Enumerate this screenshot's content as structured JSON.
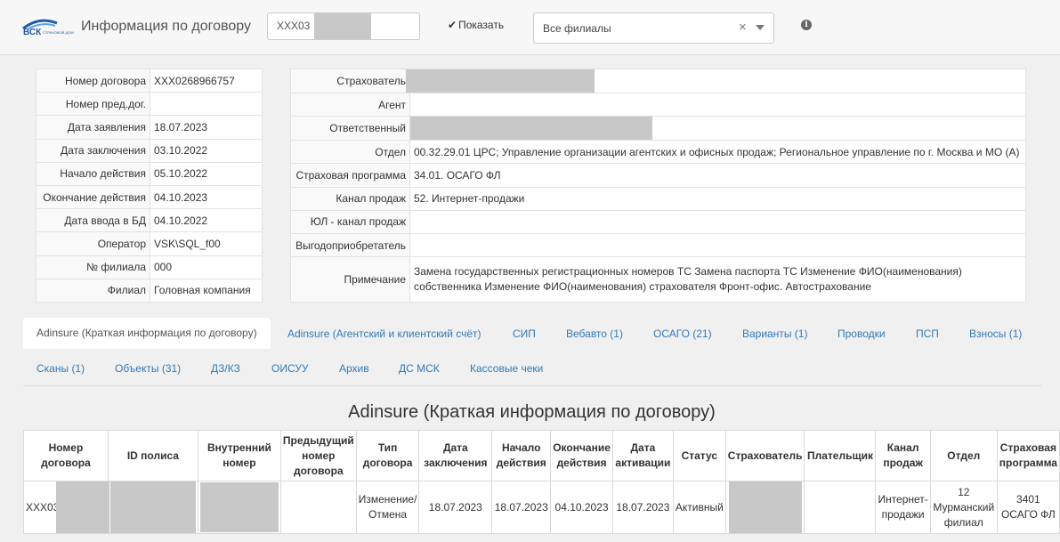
{
  "header": {
    "logo_text": "ВСК",
    "logo_subtext": "СТРАХОВОЙ ДОМ",
    "title": "Информация по договору",
    "contract_input_value": "XXX03",
    "show_label": "Показать",
    "branch_value": "Все филиалы",
    "clear_glyph": "×"
  },
  "left_info": [
    {
      "label": "Номер договора",
      "value": "XXX0268966757"
    },
    {
      "label": "Номер пред.дог.",
      "value": ""
    },
    {
      "label": "Дата заявления",
      "value": "18.07.2023"
    },
    {
      "label": "Дата заключения",
      "value": "03.10.2022"
    },
    {
      "label": "Начало действия",
      "value": "05.10.2022"
    },
    {
      "label": "Окончание действия",
      "value": "04.10.2023"
    },
    {
      "label": "Дата ввода в БД",
      "value": "04.10.2022"
    },
    {
      "label": "Оператор",
      "value": "VSK\\SQL_f00"
    },
    {
      "label": "№ филиала",
      "value": "000"
    },
    {
      "label": "Филиал",
      "value": "Головная компания"
    }
  ],
  "right_info": [
    {
      "label": "Страхователь",
      "value": ""
    },
    {
      "label": "Агент",
      "value": ""
    },
    {
      "label": "Ответственный",
      "value": ""
    },
    {
      "label": "Отдел",
      "value": "00.32.29.01 ЦРС; Управление организации агентских и офисных продаж; Региональное управление по г. Москва и МО (А)"
    },
    {
      "label": "Страховая программа",
      "value": "34.01. ОСАГО ФЛ"
    },
    {
      "label": "Канал продаж",
      "value": "52. Интернет-продажи"
    },
    {
      "label": "ЮЛ - канал продаж",
      "value": ""
    },
    {
      "label": "Выгодоприобретатель",
      "value": ""
    },
    {
      "label": "Примечание",
      "value": "Замена государственных регистрационных номеров ТС Замена паспорта ТС Изменение ФИО(наименования) собственника Изменение ФИО(наименования) страхователя Фронт-офис. Автострахование"
    }
  ],
  "tabs": [
    "Adinsure (Краткая информация по договору)",
    "Adinsure (Агентский и клиентский счёт)",
    "СИП",
    "Вебавто (1)",
    "ОСАГО (21)",
    "Варианты (1)",
    "Проводки",
    "ПСП",
    "Взносы (1)",
    "Сканы (1)",
    "Объекты (31)",
    "ДЗ/КЗ",
    "ОИСУУ",
    "Архив",
    "ДС МСК",
    "Кассовые чеки"
  ],
  "content_title": "Adinsure (Краткая информация по договору)",
  "summary_table": {
    "headers": [
      "Номер договора",
      "ID полиса",
      "Внутренний номер",
      "Предыдущий номер договора",
      "Тип договора",
      "Дата заключения",
      "Начало действия",
      "Окончание действия",
      "Дата активации",
      "Статус",
      "Страхователь",
      "Плательщик",
      "Канал продаж",
      "Отдел",
      "Страховая программа"
    ],
    "row": [
      "XXX03",
      "",
      "",
      "",
      "Изменение/ Отмена",
      "18.07.2023",
      "18.07.2023",
      "04.10.2023",
      "18.07.2023",
      "Активный",
      "",
      "",
      "Интернет-продажи",
      "12 Мурманский филиал",
      "3401 ОСАГО ФЛ"
    ]
  },
  "colors": {
    "link": "#337ab7",
    "redaction": "#c8c8c8",
    "brand": "#1e5aa6"
  }
}
